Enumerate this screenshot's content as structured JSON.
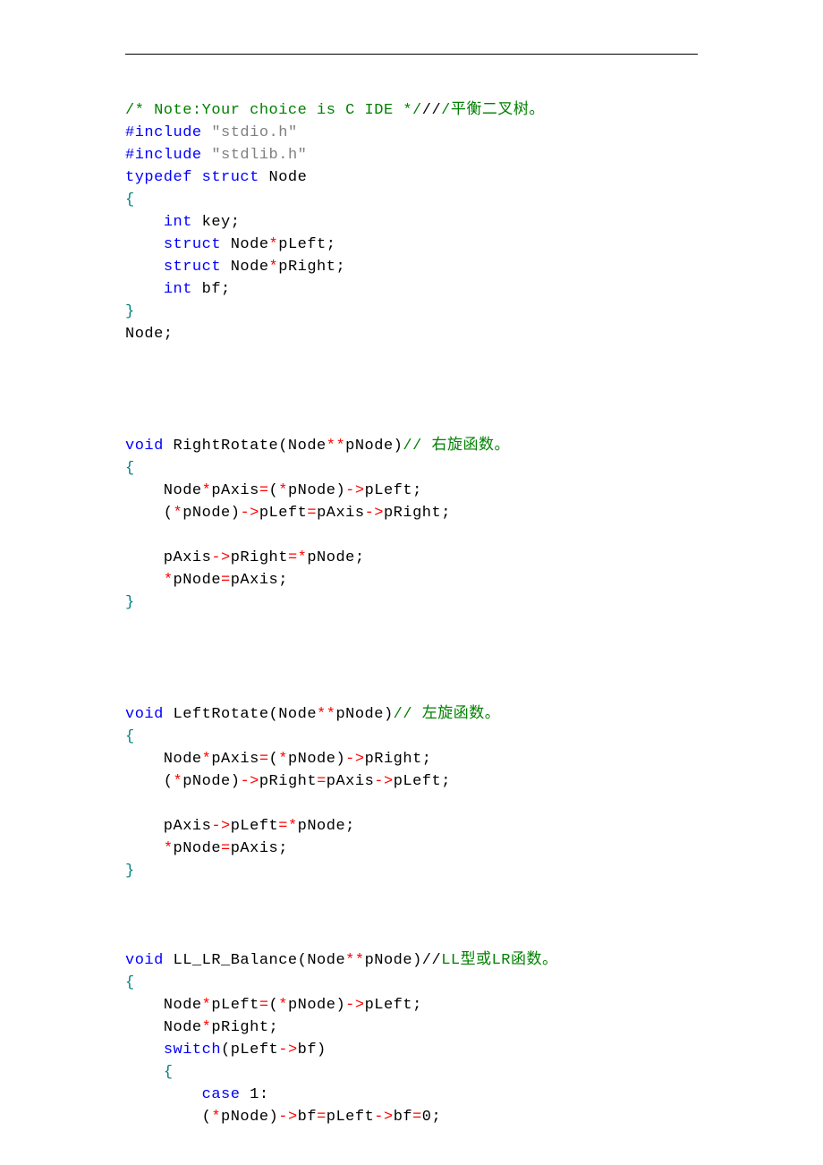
{
  "code": {
    "lines": [
      [
        {
          "cls": "c-green",
          "t": "/* Note:Your choice is C IDE */"
        },
        {
          "cls": "c-black",
          "t": "//"
        },
        {
          "cls": "c-green",
          "t": "/平衡二叉树。"
        }
      ],
      [
        {
          "cls": "c-blue",
          "t": "#include "
        },
        {
          "cls": "c-gray",
          "t": "\"stdio.h\""
        }
      ],
      [
        {
          "cls": "c-blue",
          "t": "#include "
        },
        {
          "cls": "c-gray",
          "t": "\"stdlib.h\""
        }
      ],
      [
        {
          "cls": "c-blue",
          "t": "typedef struct"
        },
        {
          "cls": "c-black",
          "t": " Node"
        }
      ],
      [
        {
          "cls": "c-teal",
          "t": "{"
        }
      ],
      [
        {
          "cls": "c-black",
          "t": "    "
        },
        {
          "cls": "c-blue",
          "t": "int"
        },
        {
          "cls": "c-black",
          "t": " key;"
        }
      ],
      [
        {
          "cls": "c-black",
          "t": "    "
        },
        {
          "cls": "c-blue",
          "t": "struct"
        },
        {
          "cls": "c-black",
          "t": " Node"
        },
        {
          "cls": "c-red",
          "t": "*"
        },
        {
          "cls": "c-black",
          "t": "pLeft;"
        }
      ],
      [
        {
          "cls": "c-black",
          "t": "    "
        },
        {
          "cls": "c-blue",
          "t": "struct"
        },
        {
          "cls": "c-black",
          "t": " Node"
        },
        {
          "cls": "c-red",
          "t": "*"
        },
        {
          "cls": "c-black",
          "t": "pRight;"
        }
      ],
      [
        {
          "cls": "c-black",
          "t": "    "
        },
        {
          "cls": "c-blue",
          "t": "int"
        },
        {
          "cls": "c-black",
          "t": " bf;"
        }
      ],
      [
        {
          "cls": "c-teal",
          "t": "}"
        }
      ],
      [
        {
          "cls": "c-black",
          "t": "Node;"
        }
      ],
      [
        {
          "cls": "c-black",
          "t": ""
        }
      ],
      [
        {
          "cls": "c-black",
          "t": ""
        }
      ],
      [
        {
          "cls": "c-black",
          "t": ""
        }
      ],
      [
        {
          "cls": "c-black",
          "t": ""
        }
      ],
      [
        {
          "cls": "c-blue",
          "t": "void"
        },
        {
          "cls": "c-black",
          "t": " RightRotate(Node"
        },
        {
          "cls": "c-red",
          "t": "**"
        },
        {
          "cls": "c-black",
          "t": "pNode)"
        },
        {
          "cls": "c-green",
          "t": "// 右旋函数。"
        }
      ],
      [
        {
          "cls": "c-teal",
          "t": "{"
        }
      ],
      [
        {
          "cls": "c-black",
          "t": "    Node"
        },
        {
          "cls": "c-red",
          "t": "*"
        },
        {
          "cls": "c-black",
          "t": "pAxis"
        },
        {
          "cls": "c-red",
          "t": "="
        },
        {
          "cls": "c-black",
          "t": "("
        },
        {
          "cls": "c-red",
          "t": "*"
        },
        {
          "cls": "c-black",
          "t": "pNode)"
        },
        {
          "cls": "c-red",
          "t": "->"
        },
        {
          "cls": "c-black",
          "t": "pLeft;"
        }
      ],
      [
        {
          "cls": "c-black",
          "t": "    ("
        },
        {
          "cls": "c-red",
          "t": "*"
        },
        {
          "cls": "c-black",
          "t": "pNode)"
        },
        {
          "cls": "c-red",
          "t": "->"
        },
        {
          "cls": "c-black",
          "t": "pLeft"
        },
        {
          "cls": "c-red",
          "t": "="
        },
        {
          "cls": "c-black",
          "t": "pAxis"
        },
        {
          "cls": "c-red",
          "t": "->"
        },
        {
          "cls": "c-black",
          "t": "pRight;"
        }
      ],
      [
        {
          "cls": "c-black",
          "t": ""
        }
      ],
      [
        {
          "cls": "c-black",
          "t": "    pAxis"
        },
        {
          "cls": "c-red",
          "t": "->"
        },
        {
          "cls": "c-black",
          "t": "pRight"
        },
        {
          "cls": "c-red",
          "t": "=*"
        },
        {
          "cls": "c-black",
          "t": "pNode;"
        }
      ],
      [
        {
          "cls": "c-black",
          "t": "    "
        },
        {
          "cls": "c-red",
          "t": "*"
        },
        {
          "cls": "c-black",
          "t": "pNode"
        },
        {
          "cls": "c-red",
          "t": "="
        },
        {
          "cls": "c-black",
          "t": "pAxis;"
        }
      ],
      [
        {
          "cls": "c-teal",
          "t": "}"
        }
      ],
      [
        {
          "cls": "c-black",
          "t": ""
        }
      ],
      [
        {
          "cls": "c-black",
          "t": ""
        }
      ],
      [
        {
          "cls": "c-black",
          "t": ""
        }
      ],
      [
        {
          "cls": "c-black",
          "t": ""
        }
      ],
      [
        {
          "cls": "c-blue",
          "t": "void"
        },
        {
          "cls": "c-black",
          "t": " LeftRotate(Node"
        },
        {
          "cls": "c-red",
          "t": "**"
        },
        {
          "cls": "c-black",
          "t": "pNode)"
        },
        {
          "cls": "c-green",
          "t": "// 左旋函数。"
        }
      ],
      [
        {
          "cls": "c-teal",
          "t": "{"
        }
      ],
      [
        {
          "cls": "c-black",
          "t": "    Node"
        },
        {
          "cls": "c-red",
          "t": "*"
        },
        {
          "cls": "c-black",
          "t": "pAxis"
        },
        {
          "cls": "c-red",
          "t": "="
        },
        {
          "cls": "c-black",
          "t": "("
        },
        {
          "cls": "c-red",
          "t": "*"
        },
        {
          "cls": "c-black",
          "t": "pNode)"
        },
        {
          "cls": "c-red",
          "t": "->"
        },
        {
          "cls": "c-black",
          "t": "pRight;"
        }
      ],
      [
        {
          "cls": "c-black",
          "t": "    ("
        },
        {
          "cls": "c-red",
          "t": "*"
        },
        {
          "cls": "c-black",
          "t": "pNode)"
        },
        {
          "cls": "c-red",
          "t": "->"
        },
        {
          "cls": "c-black",
          "t": "pRight"
        },
        {
          "cls": "c-red",
          "t": "="
        },
        {
          "cls": "c-black",
          "t": "pAxis"
        },
        {
          "cls": "c-red",
          "t": "->"
        },
        {
          "cls": "c-black",
          "t": "pLeft;"
        }
      ],
      [
        {
          "cls": "c-black",
          "t": ""
        }
      ],
      [
        {
          "cls": "c-black",
          "t": "    pAxis"
        },
        {
          "cls": "c-red",
          "t": "->"
        },
        {
          "cls": "c-black",
          "t": "pLeft"
        },
        {
          "cls": "c-red",
          "t": "=*"
        },
        {
          "cls": "c-black",
          "t": "pNode;"
        }
      ],
      [
        {
          "cls": "c-black",
          "t": "    "
        },
        {
          "cls": "c-red",
          "t": "*"
        },
        {
          "cls": "c-black",
          "t": "pNode"
        },
        {
          "cls": "c-red",
          "t": "="
        },
        {
          "cls": "c-black",
          "t": "pAxis;"
        }
      ],
      [
        {
          "cls": "c-teal",
          "t": "}"
        }
      ],
      [
        {
          "cls": "c-black",
          "t": ""
        }
      ],
      [
        {
          "cls": "c-black",
          "t": ""
        }
      ],
      [
        {
          "cls": "c-black",
          "t": ""
        }
      ],
      [
        {
          "cls": "c-blue",
          "t": "void"
        },
        {
          "cls": "c-black",
          "t": " LL_LR_Balance(Node"
        },
        {
          "cls": "c-red",
          "t": "**"
        },
        {
          "cls": "c-black",
          "t": "pNode)//"
        },
        {
          "cls": "c-green",
          "t": "LL型或LR函数。"
        }
      ],
      [
        {
          "cls": "c-teal",
          "t": "{"
        }
      ],
      [
        {
          "cls": "c-black",
          "t": "    Node"
        },
        {
          "cls": "c-red",
          "t": "*"
        },
        {
          "cls": "c-black",
          "t": "pLeft"
        },
        {
          "cls": "c-red",
          "t": "="
        },
        {
          "cls": "c-black",
          "t": "("
        },
        {
          "cls": "c-red",
          "t": "*"
        },
        {
          "cls": "c-black",
          "t": "pNode)"
        },
        {
          "cls": "c-red",
          "t": "->"
        },
        {
          "cls": "c-black",
          "t": "pLeft;"
        }
      ],
      [
        {
          "cls": "c-black",
          "t": "    Node"
        },
        {
          "cls": "c-red",
          "t": "*"
        },
        {
          "cls": "c-black",
          "t": "pRight;"
        }
      ],
      [
        {
          "cls": "c-black",
          "t": "    "
        },
        {
          "cls": "c-blue",
          "t": "switch"
        },
        {
          "cls": "c-black",
          "t": "(pLeft"
        },
        {
          "cls": "c-red",
          "t": "->"
        },
        {
          "cls": "c-black",
          "t": "bf)"
        }
      ],
      [
        {
          "cls": "c-black",
          "t": "    "
        },
        {
          "cls": "c-teal",
          "t": "{"
        }
      ],
      [
        {
          "cls": "c-black",
          "t": "        "
        },
        {
          "cls": "c-blue",
          "t": "case"
        },
        {
          "cls": "c-black",
          "t": " 1:"
        }
      ],
      [
        {
          "cls": "c-black",
          "t": "        ("
        },
        {
          "cls": "c-red",
          "t": "*"
        },
        {
          "cls": "c-black",
          "t": "pNode)"
        },
        {
          "cls": "c-red",
          "t": "->"
        },
        {
          "cls": "c-black",
          "t": "bf"
        },
        {
          "cls": "c-red",
          "t": "="
        },
        {
          "cls": "c-black",
          "t": "pLeft"
        },
        {
          "cls": "c-red",
          "t": "->"
        },
        {
          "cls": "c-black",
          "t": "bf"
        },
        {
          "cls": "c-red",
          "t": "="
        },
        {
          "cls": "c-black",
          "t": "0;"
        }
      ]
    ]
  }
}
